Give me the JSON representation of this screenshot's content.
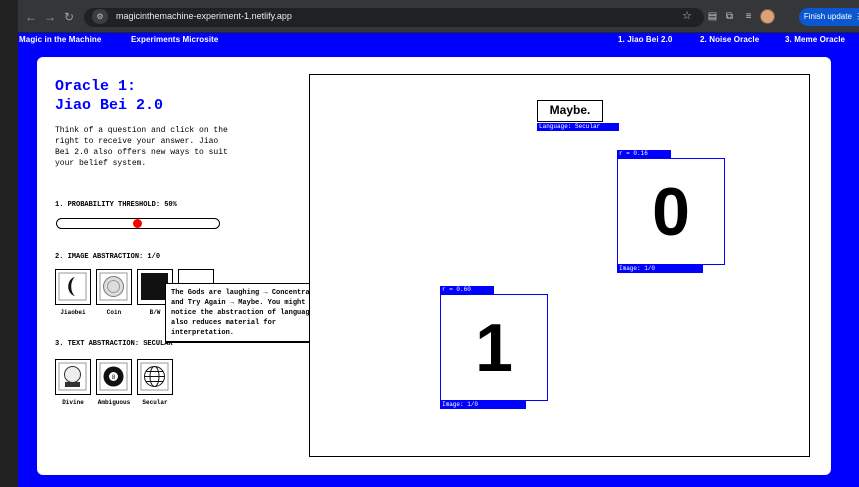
{
  "browser": {
    "url": "magicinthemachine-experiment-1.netlify.app",
    "finish_update": "Finish update"
  },
  "site_nav": {
    "brand": "Magic in the Machine",
    "microsite": "Experiments Microsite",
    "links": [
      "1. Jiao Bei 2.0",
      "2. Noise Oracle",
      "3. Meme Oracle"
    ]
  },
  "oracle": {
    "title_line1": "Oracle 1:",
    "title_line2": "Jiao Bei 2.0",
    "intro": "Think of a question and click on the right to receive your answer. Jiao Bei 2.0 also offers new ways to suit your belief system."
  },
  "controls": {
    "probability_label": "1. PROBABILITY THRESHOLD: 50%",
    "probability_value": 0.5,
    "image_abstraction_label": "2. IMAGE ABSTRACTION: 1/0",
    "image_options": [
      "Jiaobei",
      "Coin",
      "B/W",
      ""
    ],
    "text_abstraction_label": "3. TEXT ABSTRACTION: SECULAR",
    "text_options": [
      "Divine",
      "Ambiguous",
      "Secular"
    ]
  },
  "tooltip": {
    "text": "The Gods are laughing → Concentrate and Try Again → Maybe. You might notice the abstraction of language also reduces material for interpretation."
  },
  "result": {
    "answer": "Maybe.",
    "answer_tag": "Language: Secular",
    "block_a": {
      "r_label": "r = 0.16",
      "digit": "0",
      "image_tag": "Image: 1/0"
    },
    "block_b": {
      "r_label": "r = 0.60",
      "digit": "1",
      "image_tag": "Image: 1/0"
    }
  }
}
